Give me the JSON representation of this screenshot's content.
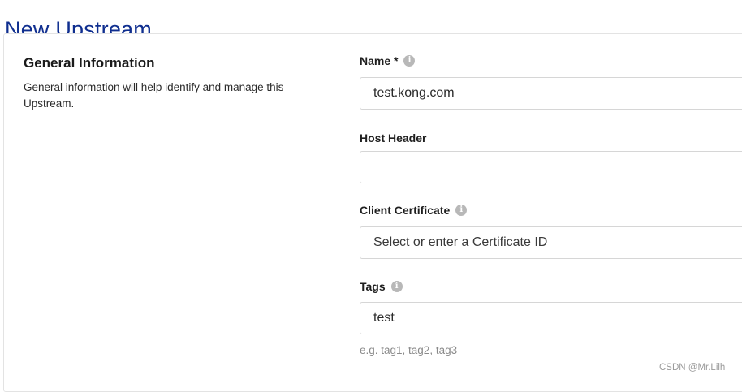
{
  "page": {
    "title": "New Upstream"
  },
  "section": {
    "title": "General Information",
    "description": "General information will help identify and manage this Upstream."
  },
  "fields": {
    "name": {
      "label": "Name *",
      "value": "test.kong.com",
      "info_icon": "info-icon"
    },
    "host_header": {
      "label": "Host Header",
      "value": ""
    },
    "client_certificate": {
      "label": "Client Certificate",
      "placeholder": "Select or enter a Certificate ID",
      "info_icon": "info-icon"
    },
    "tags": {
      "label": "Tags",
      "value": "test",
      "hint": "e.g. tag1, tag2, tag3",
      "info_icon": "info-icon"
    }
  },
  "watermark": "CSDN @Mr.Lilh",
  "colors": {
    "title": "#0f2e8f",
    "info_icon": "#b8b8b8",
    "border": "#d6d6d6"
  }
}
